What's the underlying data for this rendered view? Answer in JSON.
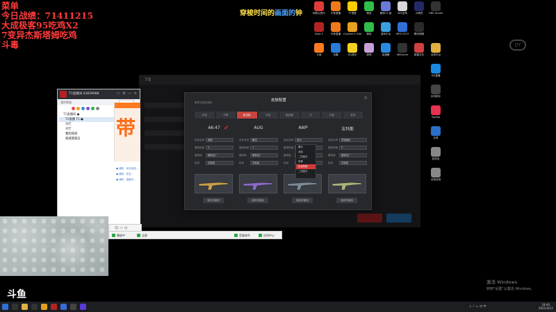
{
  "overlay": {
    "lines": [
      "菜单",
      "今日战绩：71411215",
      "大成极客95吃鸡X2",
      "7变异杰斯塔姆吃鸡",
      "斗毒"
    ],
    "top_left": "穿梭时间的",
    "top_accent": "画面的",
    "top_right": "钟",
    "logo": "斗鱼"
  },
  "desktop_icons": [
    {
      "label": "网易云音乐",
      "color": "#e03b3b"
    },
    {
      "label": "头条直播",
      "color": "#f07a1a"
    },
    {
      "label": "YY语音",
      "color": "#ffcc00"
    },
    {
      "label": "微信",
      "color": "#2fbf4a"
    },
    {
      "label": "随机13 画",
      "color": "#6a7ad8"
    },
    {
      "label": "SEE全球",
      "color": "#d8d8d8"
    },
    {
      "label": "小精灵",
      "color": "#222a66"
    },
    {
      "label": "OBS Studio",
      "color": "#333"
    },
    {
      "label": "Dota 2",
      "color": "#b22424"
    },
    {
      "label": "头条直播",
      "color": "#f07a1a"
    },
    {
      "label": "Counter-S Global Off",
      "color": "#e8a020"
    },
    {
      "label": "微信",
      "color": "#2fbf4a"
    },
    {
      "label": "游戏平台",
      "color": "#3aa0e0"
    },
    {
      "label": "WPS 2019",
      "color": "#2f6fd8"
    },
    {
      "label": "腾讯视频",
      "color": "#2a2a2a"
    },
    {
      "label": "",
      "color": "#000"
    },
    {
      "label": "斗鱼",
      "color": "#ff7a20"
    },
    {
      "label": "迅雷",
      "color": "#2a7ad8"
    },
    {
      "label": "QQ音乐",
      "color": "#f5d020"
    },
    {
      "label": "原神",
      "color": "#c7a0d8"
    },
    {
      "label": "加速器",
      "color": "#2a8ae0"
    },
    {
      "label": "WeGame",
      "color": "#333"
    },
    {
      "label": "新建文件",
      "color": "#d04040"
    },
    {
      "label": "全球平台",
      "color": "#e0b040"
    },
    {
      "label": "QQ直播",
      "color": "#1a8ae0"
    },
    {
      "label": "手机助手",
      "color": "#444"
    },
    {
      "label": "TapTap",
      "color": "#e83050"
    },
    {
      "label": "共享",
      "color": "#2a70c8"
    },
    {
      "label": "回收站",
      "color": "#888"
    },
    {
      "label": "全球战场",
      "color": "#888"
    }
  ],
  "chat": {
    "title": "T1直播间 43839988",
    "tabs": [
      "我的频道",
      "全部"
    ],
    "tree": [
      "T1直播间 ●",
      "T1直播 T1 ●",
      "大厅",
      "大厅",
      "我的频道",
      "频道管理员"
    ],
    "preview_rows": [
      "● 通知：优化连接...",
      "● 通知：发言...",
      "● 通知：直播中..."
    ]
  },
  "statusbar": {
    "left": "播放中",
    "mid": "全屏",
    "right1": "音量调节",
    "right2": "应用中心"
  },
  "modal": {
    "title": "皮肤配置",
    "subtitle": "服务当前的皮肤",
    "close": "×",
    "tabs": [
      "步枪",
      "冲锋",
      "狙击枪",
      "手枪",
      "重武器",
      "刀",
      "手套",
      "其他"
    ],
    "active_tab_index": 2,
    "weapons": [
      "AK-47",
      "AUG",
      "AWP",
      "法玛斯"
    ],
    "field_labels": [
      "皮肤名称",
      "磨损程度",
      "磨损值",
      "贴纸"
    ],
    "columns": [
      {
        "values": [
          "皮肤",
          "5",
          "崭新出厂",
          "无贴纸"
        ],
        "button": "保存并使用"
      },
      {
        "values": [
          "雷击",
          "1",
          "崭新出厂",
          "无贴纸"
        ],
        "button": "保存并使用"
      },
      {
        "values": [
          "龙王",
          "1",
          "崭新出厂",
          "无贴纸"
        ],
        "button": "保存并使用"
      },
      {
        "values": [
          "荒漠迷彩",
          "5",
          "崭新出厂",
          "无贴纸"
        ],
        "button": "保存并使用"
      }
    ]
  },
  "dropdown": {
    "options": [
      "雷击",
      "龙狙",
      "二西莫夫",
      "死神",
      "巨龙传说",
      "二西莫夫"
    ],
    "highlighted_index": 4
  },
  "windows_activation": {
    "line1": "激活 Windows",
    "line2": "转到\"设置\"以激活 Windows。"
  },
  "taskbar": {
    "time": "18:40",
    "date": "2021/4/13"
  }
}
